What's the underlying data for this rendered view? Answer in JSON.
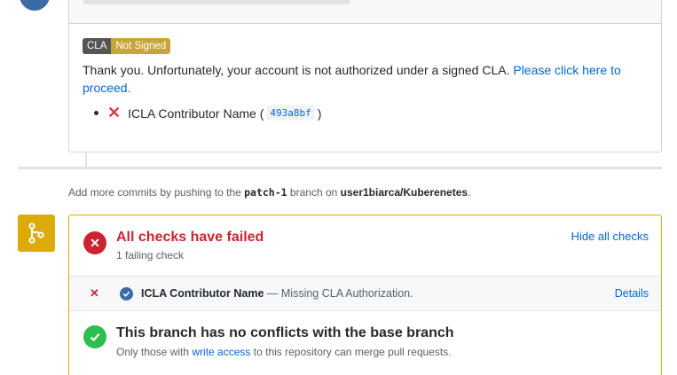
{
  "cla_comment": {
    "badge_left": "CLA",
    "badge_right": "Not Signed",
    "message": "Thank you. Unfortunately, your account is not authorized under a signed CLA.",
    "link_text": "Please click here to proceed.",
    "item_label": "ICLA Contributor Name (",
    "item_commit": "493a8bf",
    "item_close": ")"
  },
  "push_hint": {
    "prefix": "Add more commits by pushing to the",
    "branch": "patch-1",
    "middle": "branch on",
    "repo": "user1biarca/Kuberenetes",
    "suffix": "."
  },
  "checks": {
    "title": "All checks have failed",
    "subtitle": "1 failing check",
    "toggle_label": "Hide all checks",
    "rows": [
      {
        "name": "ICLA Contributor Name",
        "description": "— Missing CLA Authorization.",
        "link": "Details"
      }
    ]
  },
  "merge": {
    "title": "This branch has no conflicts with the base branch",
    "sub_prefix": "Only those with",
    "sub_link": "write access",
    "sub_suffix": "to this repository can merge pull requests."
  },
  "colors": {
    "fail": "#cb2431",
    "success": "#2cbe4e",
    "warning": "#dbab09",
    "link": "#0366d6"
  }
}
